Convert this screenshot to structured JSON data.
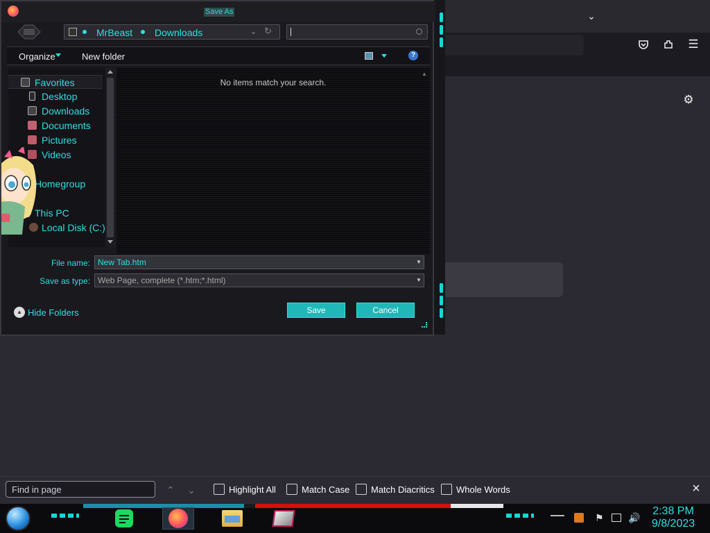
{
  "dialog": {
    "title": "Save As",
    "breadcrumb": [
      "MrBeast",
      "Downloads"
    ],
    "toolbar": {
      "organize": "Organize",
      "new_folder": "New folder"
    },
    "nav": [
      {
        "label": "Favorites",
        "icon": "star-icon"
      },
      {
        "label": "Desktop",
        "icon": "desktop-icon"
      },
      {
        "label": "Downloads",
        "icon": "downloads-icon"
      },
      {
        "label": "Documents",
        "icon": "documents-icon"
      },
      {
        "label": "Pictures",
        "icon": "pictures-icon"
      },
      {
        "label": "Videos",
        "icon": "videos-icon"
      },
      {
        "label": "Homegroup",
        "icon": "homegroup-icon"
      },
      {
        "label": "This PC",
        "icon": "pc-icon"
      },
      {
        "label": "Local Disk (C:)",
        "icon": "disk-icon"
      }
    ],
    "empty_message": "No items match your search.",
    "file_name_label": "File name:",
    "file_name_value": "New Tab.htm",
    "save_type_label": "Save as type:",
    "save_type_value": "Web Page, complete (*.htm;*.html)",
    "hide_folders": "Hide Folders",
    "save": "Save",
    "cancel": "Cancel"
  },
  "findbar": {
    "placeholder": "Find in page",
    "options": [
      "Highlight All",
      "Match Case",
      "Match Diacritics",
      "Whole Words"
    ]
  },
  "taskbar": {
    "time": "2:38 PM",
    "date": "9/8/2023"
  },
  "colors": {
    "accent": "#2ce0e0",
    "button": "#1fb7b7"
  }
}
